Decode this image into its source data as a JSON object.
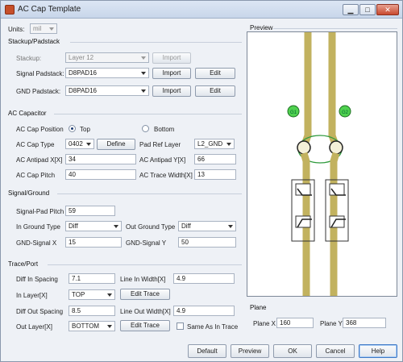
{
  "window": {
    "title": "AC Cap Template",
    "controls": {
      "minimize": "▁",
      "maximize": "□",
      "close": "✕"
    }
  },
  "units": {
    "label": "Units:",
    "value": "mil"
  },
  "stackup": {
    "section": "Stackup/Padstack",
    "stackup_label": "Stackup:",
    "stackup_value": "Layer 12",
    "import_label": "Import",
    "signal_label": "Signal Padstack:",
    "signal_value": "D8PAD16",
    "gnd_label": "GND Padstack:",
    "gnd_value": "D8PAD16",
    "edit_label": "Edit"
  },
  "ac_cap": {
    "section": "AC Capacitor",
    "position_label": "AC Cap Position",
    "top_label": "Top",
    "bottom_label": "Bottom",
    "position_selected": "Top",
    "type_label": "AC Cap Type",
    "type_value": "0402",
    "define_label": "Define",
    "pad_ref_label": "Pad Ref Layer",
    "pad_ref_value": "L2_GND",
    "antipad_x_label": "AC Antipad X[X]",
    "antipad_x_value": "34",
    "antipad_y_label": "AC Antipad Y[X]",
    "antipad_y_value": "66",
    "pitch_label": "AC Cap Pitch",
    "pitch_value": "40",
    "trace_width_label": "AC Trace Width[X]",
    "trace_width_value": "13"
  },
  "signal_ground": {
    "section": "Signal/Ground",
    "pad_pitch_label": "Signal-Pad Pitch",
    "pad_pitch_value": "59",
    "in_ground_label": "In Ground Type",
    "in_ground_value": "Diff",
    "out_ground_label": "Out Ground Type",
    "out_ground_value": "Diff",
    "gnd_signal_x_label": "GND-Signal X",
    "gnd_signal_x_value": "15",
    "gnd_signal_y_label": "GND-Signal Y",
    "gnd_signal_y_value": "50"
  },
  "trace_port": {
    "section": "Trace/Port",
    "diff_in_label": "Diff In Spacing",
    "diff_in_value": "7.1",
    "line_in_label": "Line In Width[X]",
    "line_in_value": "4.9",
    "in_layer_label": "In Layer[X]",
    "in_layer_value": "TOP",
    "edit_trace_label": "Edit Trace",
    "diff_out_label": "Diff Out Spacing",
    "diff_out_value": "8.5",
    "line_out_label": "Line Out Width[X]",
    "line_out_value": "4.9",
    "out_layer_label": "Out Layer[X]",
    "out_layer_value": "BOTTOM",
    "same_as_in_label": "Same As In Trace"
  },
  "preview": {
    "section": "Preview",
    "pad_label_left": "G1",
    "pad_label_right": "G2"
  },
  "plane": {
    "section": "Plane",
    "x_label": "Plane X",
    "x_value": "160",
    "y_label": "Plane Y",
    "y_value": "368"
  },
  "footer": {
    "default_label": "Default",
    "preview_label": "Preview",
    "ok_label": "OK",
    "cancel_label": "Cancel",
    "help_label": "Help"
  },
  "colors": {
    "trace": "#c2b25f",
    "via_ring": "#2e9a3c",
    "pad_fill": "#4fd14f"
  }
}
